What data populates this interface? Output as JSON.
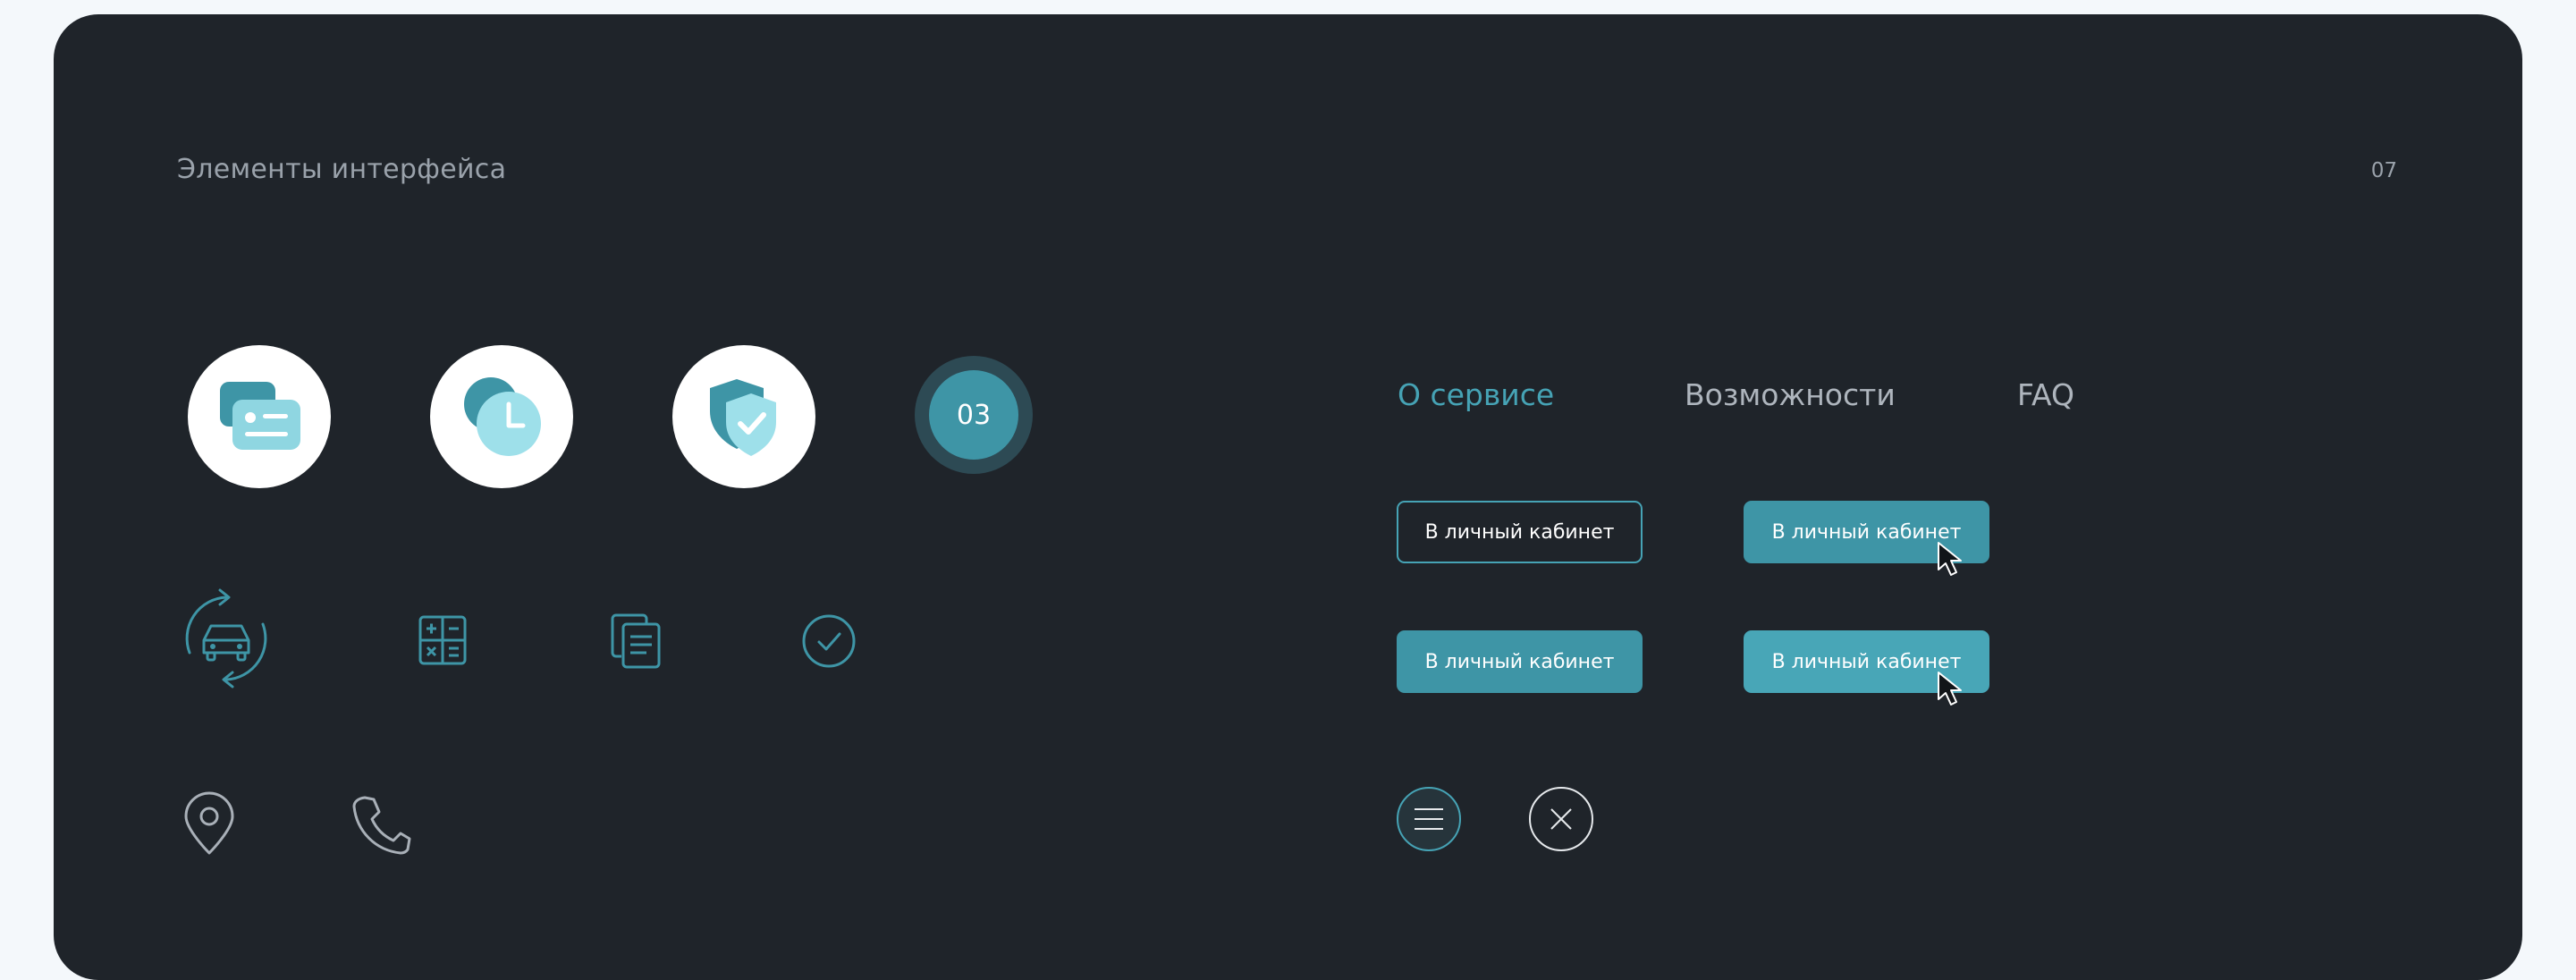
{
  "header": {
    "section_title": "Элементы интерфейса",
    "page_number": "07"
  },
  "feature_icons": [
    "id-card-icon",
    "clock-icon",
    "shield-check-icon"
  ],
  "step_badge": {
    "label": "03"
  },
  "line_icons": [
    "car-refresh-icon",
    "calculator-icon",
    "documents-icon",
    "check-circle-icon"
  ],
  "contact_icons": [
    "location-pin-icon",
    "phone-icon"
  ],
  "nav": {
    "tabs": [
      {
        "label": "О сервисе",
        "active": true
      },
      {
        "label": "Возможности",
        "active": false
      },
      {
        "label": "FAQ",
        "active": false
      }
    ]
  },
  "buttons": {
    "outline_label": "В личный кабинет",
    "filled_hover_label": "В личный кабинет",
    "filled_label": "В личный кабинет",
    "filled_pressed_label": "В личный кабинет"
  },
  "round_buttons": [
    "menu-icon",
    "close-icon"
  ],
  "colors": {
    "panel_background": "#1f242a",
    "accent": "#3e95a6",
    "accent_light": "#46a3b5",
    "muted_text": "#9aa2ab",
    "page_background": "#f4f8fb"
  }
}
